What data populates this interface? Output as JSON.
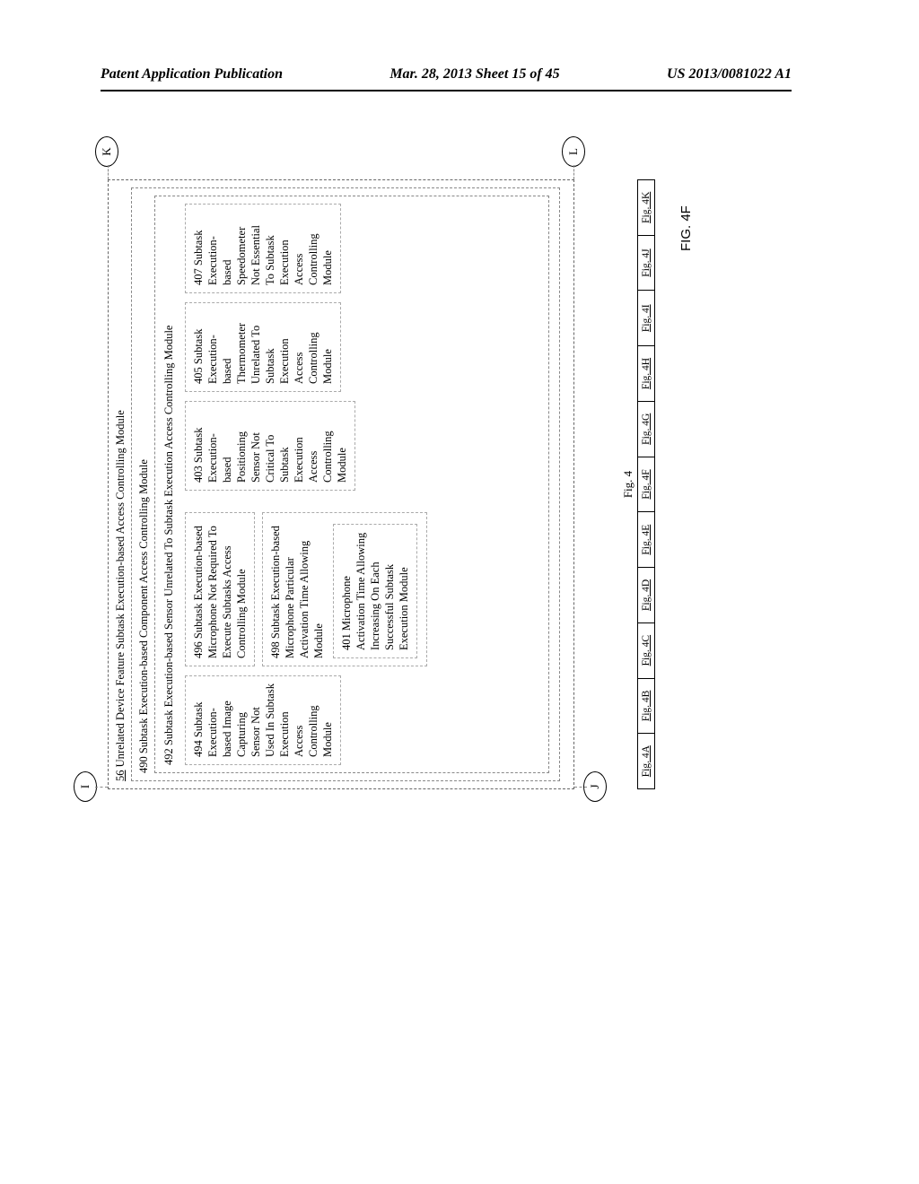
{
  "header": {
    "left": "Patent Application Publication",
    "center": "Mar. 28, 2013  Sheet 15 of 45",
    "right": "US 2013/0081022 A1"
  },
  "connectors": {
    "I": "I",
    "J": "J",
    "K": "K",
    "L": "L"
  },
  "outer_title_num": "56",
  "outer_title": "Unrelated Device Feature Subtask Execution-based Access Controlling Module",
  "mid_title": "490 Subtask Execution-based Component Access Controlling Module",
  "inner_title": "492 Subtask Execution-based Sensor Unrelated To Subtask Execution Access Controlling Module",
  "boxes": {
    "b494": "494 Subtask Execution-based Image Capturing Sensor Not Used In Subtask Execution Access Controlling Module",
    "b496": "496 Subtask Execution-based Microphone Not Required To Execute Subtasks Access Controlling Module",
    "b498": "498 Subtask Execution-based Microphone Particular Activation Time Allowing Module",
    "b401": "401 Microphone Activation Time Allowing Increasing On Each Successful Subtask Execution Module",
    "b403": "403 Subtask Execution-based Positioning Sensor Not Critical To Subtask Execution Access Controlling Module",
    "b405": "405 Subtask Execution-based Thermometer Unrelated To Subtask Execution Access Controlling Module",
    "b407": "407 Subtask Execution-based Speedometer Not Essential To Subtask Execution Access Controlling Module"
  },
  "fig_label": "Fig. 4",
  "strip": [
    "Fig. 4A",
    "Fig. 4B",
    "Fig. 4C",
    "Fig. 4D",
    "Fig. 4E",
    "Fig. 4F",
    "Fig. 4G",
    "Fig. 4H",
    "Fig. 4I",
    "Fig. 4J",
    "Fig. 4K"
  ],
  "fig_caption": "FIG. 4F"
}
